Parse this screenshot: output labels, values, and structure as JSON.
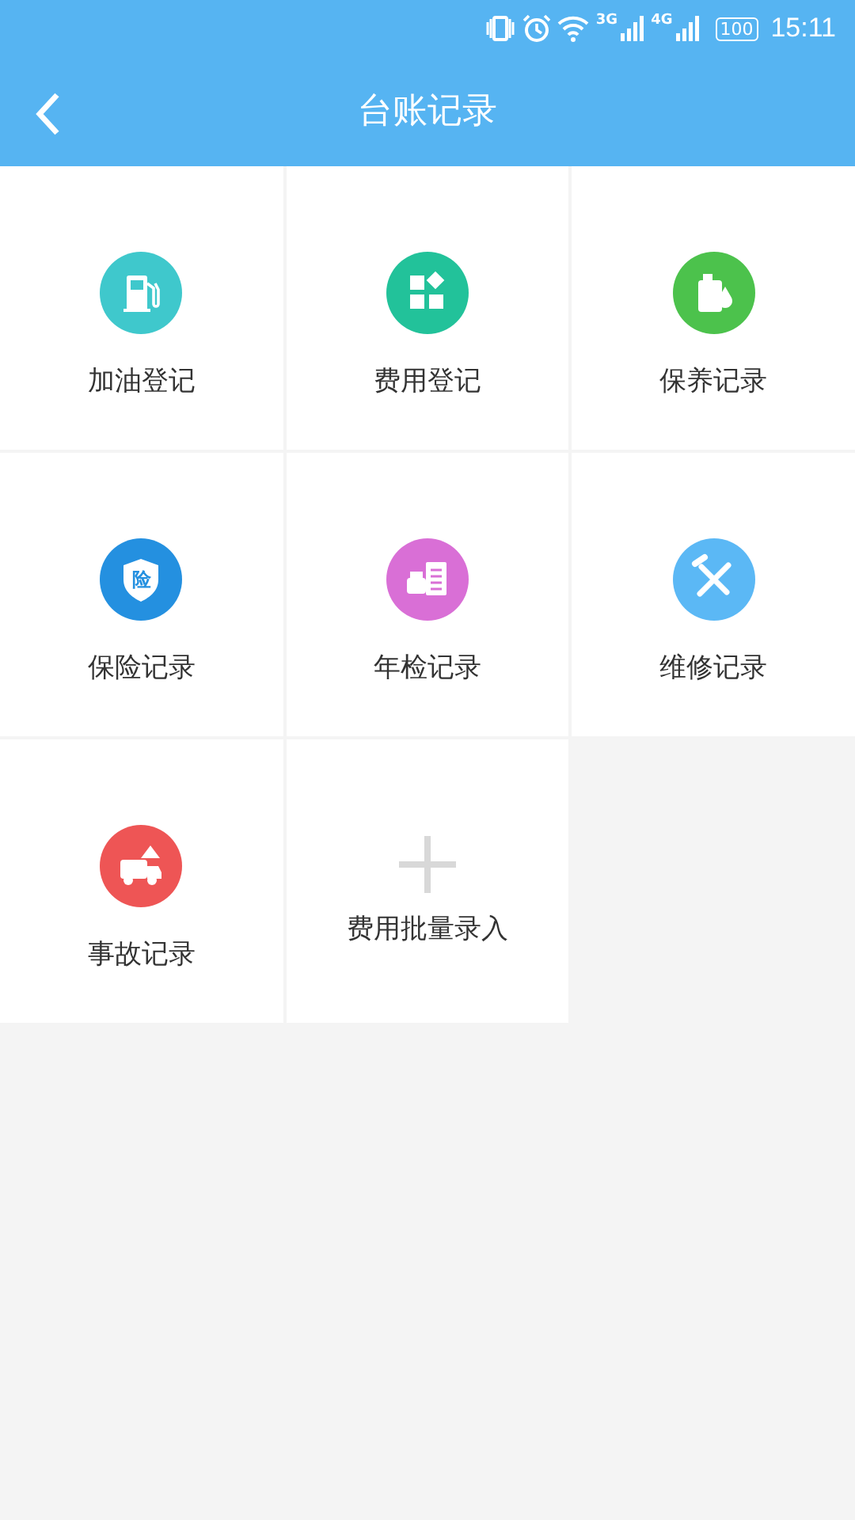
{
  "status_bar": {
    "network_1": "3G",
    "network_2": "4G",
    "battery": "100",
    "time": "15:11"
  },
  "header": {
    "title": "台账记录"
  },
  "grid": [
    {
      "kind": "entry",
      "label": "加油登记",
      "color": "#3fc8cc"
    },
    {
      "kind": "entry",
      "label": "费用登记",
      "color": "#22c29a"
    },
    {
      "kind": "entry",
      "label": "保养记录",
      "color": "#4cc24c"
    },
    {
      "kind": "entry",
      "label": "保险记录",
      "color": "#2490e0",
      "icon_text": "险"
    },
    {
      "kind": "entry",
      "label": "年检记录",
      "color": "#d96fd6"
    },
    {
      "kind": "entry",
      "label": "维修记录",
      "color": "#5bb8f5"
    },
    {
      "kind": "entry",
      "label": "事故记录",
      "color": "#ee5555"
    },
    {
      "kind": "add",
      "label": "费用批量录入"
    }
  ]
}
